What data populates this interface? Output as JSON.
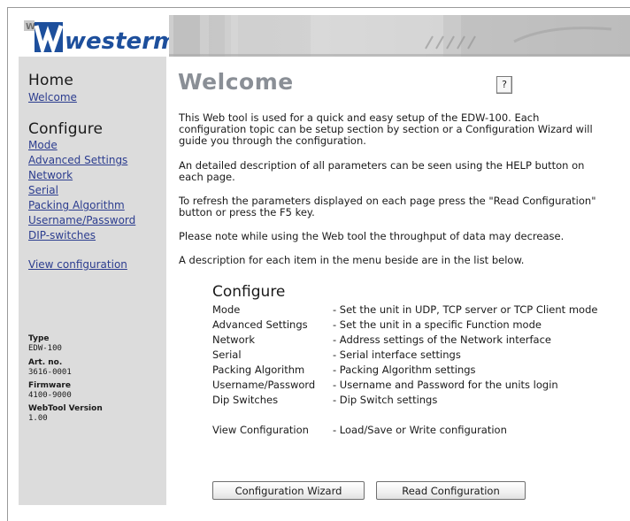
{
  "logo": {
    "text": "westermo"
  },
  "sidebar": {
    "home_heading": "Home",
    "home_links": [
      {
        "label": "Welcome"
      }
    ],
    "configure_heading": "Configure",
    "configure_links": [
      {
        "label": "Mode"
      },
      {
        "label": "Advanced Settings"
      },
      {
        "label": "Network"
      },
      {
        "label": "Serial"
      },
      {
        "label": "Packing Algorithm"
      },
      {
        "label": "Username/Password"
      },
      {
        "label": "DIP-switches"
      }
    ],
    "view_configuration_link": "View configuration",
    "device_info": [
      {
        "label": "Type",
        "value": "EDW-100"
      },
      {
        "label": "Art. no.",
        "value": "3616-0001"
      },
      {
        "label": "Firmware",
        "value": "4100-9000"
      },
      {
        "label": "WebTool Version",
        "value": "1.00"
      }
    ]
  },
  "main": {
    "title": "Welcome",
    "help_label": "?",
    "paragraphs": [
      "This Web tool is used for a quick and easy setup of the EDW-100. Each configuration topic can be setup section by section or a Configuration Wizard will guide you through the configuration.",
      "An detailed description of all parameters can be seen using the HELP button on each page.",
      "To refresh the parameters displayed on each page press the \"Read Configuration\" button or press the F5 key.",
      "Please note while using the Web tool the throughput of data may decrease.",
      "A description for each item in the menu beside are in the list below."
    ],
    "configure_section": {
      "heading": "Configure",
      "items": [
        {
          "name": "Mode",
          "description": "- Set the unit in UDP, TCP server or TCP Client mode"
        },
        {
          "name": "Advanced Settings",
          "description": "- Set the unit in a specific Function mode"
        },
        {
          "name": "Network",
          "description": "- Address settings of the Network interface"
        },
        {
          "name": "Serial",
          "description": "- Serial interface settings"
        },
        {
          "name": "Packing Algorithm",
          "description": "- Packing Algorithm settings"
        },
        {
          "name": "Username/Password",
          "description": "- Username and Password for the units login"
        },
        {
          "name": "Dip Switches",
          "description": "- Dip Switch settings"
        },
        {
          "name": "View Configuration",
          "description": "- Load/Save or Write configuration"
        }
      ]
    },
    "buttons": {
      "wizard": "Configuration Wizard",
      "read": "Read Configuration"
    }
  },
  "colors": {
    "sidebar_bg": "#dcdcdc",
    "link": "#2c3d8f",
    "title": "#8a8f96",
    "logo_blue": "#1d4f9c"
  }
}
